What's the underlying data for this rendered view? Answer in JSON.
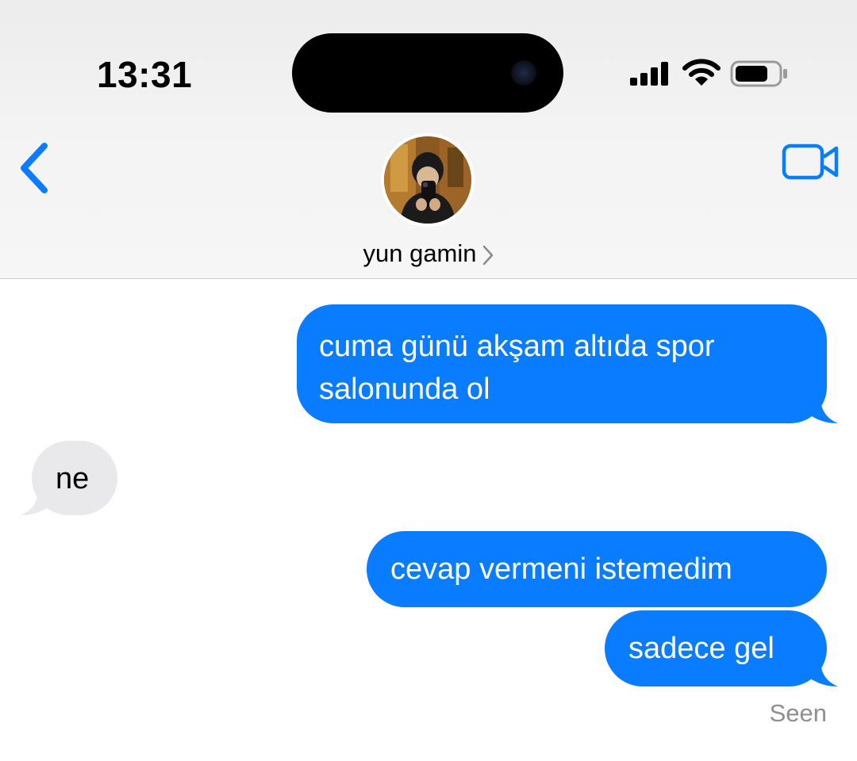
{
  "status_bar": {
    "time": "13:31"
  },
  "nav": {
    "contact_name": "yun gamin",
    "back_icon": "chevron-left-icon",
    "video_icon": "video-camera-icon",
    "accent_color": "#0a7cff"
  },
  "messages": [
    {
      "direction": "sent",
      "text": "cuma günü akşam altıda spor salonunda ol"
    },
    {
      "direction": "received",
      "text": "ne"
    },
    {
      "direction": "sent",
      "text": "cevap vermeni istemedim"
    },
    {
      "direction": "sent",
      "text": "sadece gel"
    }
  ],
  "receipt": "Seen",
  "colors": {
    "sent_bubble": "#0a7cff",
    "received_bubble": "#e9e9eb",
    "receipt_text": "#8e8e93"
  }
}
